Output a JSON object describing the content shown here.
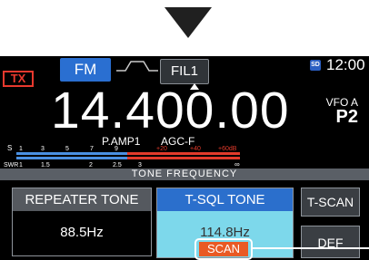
{
  "header": {
    "tx_label": "TX",
    "mode": "FM",
    "filter": "FIL1",
    "clock": "12:00",
    "sd_label": "SD"
  },
  "main": {
    "frequency": "14.400.00",
    "vfo_label": "VFO A",
    "memory_label": "P2",
    "preamp": "P.AMP1",
    "agc": "AGC-F"
  },
  "meter": {
    "s_label": "S",
    "s_ticks": [
      "1",
      "3",
      "5",
      "7",
      "9",
      "+20",
      "+40",
      "+60dB"
    ],
    "swr_label": "SWR",
    "swr_ticks": [
      "1",
      "1.5",
      "2",
      "2.5",
      "3",
      "∞"
    ]
  },
  "tone": {
    "title": "TONE FREQUENCY",
    "repeater_label": "REPEATER TONE",
    "repeater_value": "88.5Hz",
    "tsql_label": "T-SQL TONE",
    "tsql_value": "114.8Hz",
    "tscan_label": "T-SCAN",
    "def_label": "DEF",
    "scan_badge": "SCAN"
  },
  "colors": {
    "tx_red": "#e8392e",
    "mode_blue": "#2a6fd1",
    "tsql_cyan": "#7dd8eb",
    "scan_orange": "#e95a24",
    "meter_red": "#e23a2b"
  }
}
